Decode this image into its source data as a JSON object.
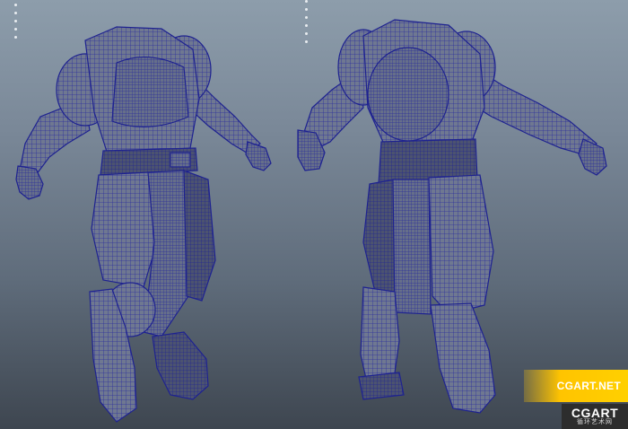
{
  "viewport": {
    "background_top": "#8d9dab",
    "background_bottom": "#3e4650",
    "wireframe_color": "#2a2aa0",
    "mesh_fill": "#6f7891"
  },
  "models": [
    {
      "name": "armor-front-view",
      "view": "front"
    },
    {
      "name": "armor-back-view",
      "view": "back"
    }
  ],
  "watermark": {
    "site": "CGART.NET",
    "brand": "CGART",
    "sub": "循环艺术网",
    "accent": "#ffc400"
  }
}
